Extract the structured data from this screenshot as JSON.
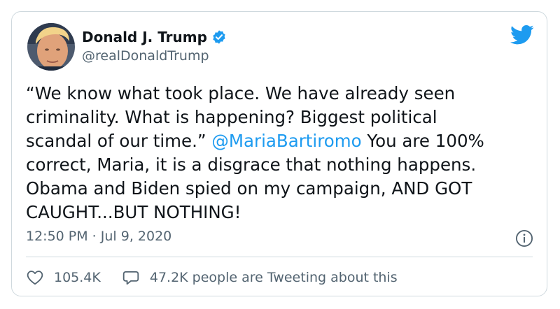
{
  "author": {
    "display_name": "Donald J. Trump",
    "handle": "@realDonaldTrump",
    "verified": true
  },
  "tweet": {
    "lines": [
      {
        "before": "“We know what took place. We have already seen",
        "mention": "",
        "after": ""
      },
      {
        "before": "criminality. What is happening? Biggest political",
        "mention": "",
        "after": ""
      },
      {
        "before": "scandal of our time.” ",
        "mention": "@MariaBartiromo",
        "after": " You are 100%"
      },
      {
        "before": "correct, Maria, it is a disgrace that nothing happens.",
        "mention": "",
        "after": ""
      },
      {
        "before": "Obama and Biden spied on my campaign, AND GOT",
        "mention": "",
        "after": ""
      },
      {
        "before": "CAUGHT...BUT NOTHING!",
        "mention": "",
        "after": ""
      }
    ],
    "timestamp": "12:50 PM · Jul 9, 2020"
  },
  "engagement": {
    "likes": "105.4K",
    "conversation": "47.2K people are Tweeting about this"
  },
  "icons": {
    "brand": "twitter-bird-icon",
    "verified": "verified-badge-icon",
    "info": "info-icon",
    "like": "heart-icon",
    "reply": "speech-bubble-icon"
  },
  "colors": {
    "accent": "#1d9bf0",
    "text": "#0f1419",
    "secondary": "#536471",
    "border": "#cfd9de"
  }
}
